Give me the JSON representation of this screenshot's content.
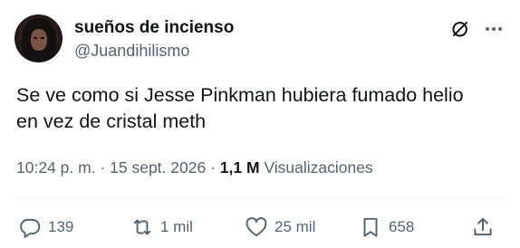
{
  "author": {
    "display_name": "sueños de incienso",
    "handle": "@Juandihilismo",
    "avatar_icon": "profile-avatar"
  },
  "tweet": {
    "text_line1": "Se ve como si Jesse Pinkman hubiera fumado helio",
    "text_line2": "en vez de cristal meth"
  },
  "meta": {
    "time": "10:24 p. m.",
    "separator": "·",
    "date": "15 sept. 2026",
    "views_count": "1,1 M",
    "views_label": "Visualizaciones"
  },
  "actions": {
    "replies": "139",
    "reposts": "1 mil",
    "likes": "25 mil",
    "bookmarks": "658"
  },
  "colors": {
    "text_primary": "#0f1419",
    "text_secondary": "#536471",
    "divider": "#eff3f4"
  }
}
